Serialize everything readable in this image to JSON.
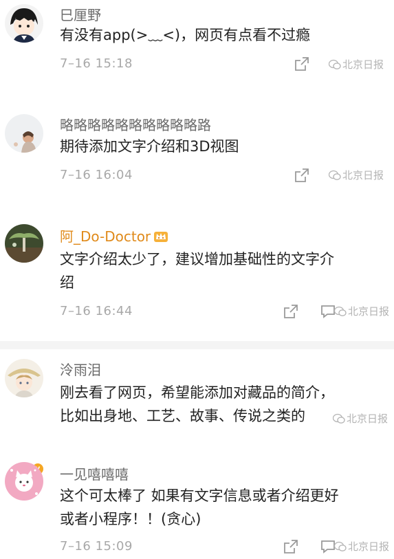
{
  "watermark": "北京日报",
  "comments": [
    {
      "username": "巳厘野",
      "text": [
        "有没有app(>﹏<)，网页有点看不过瘾"
      ],
      "time": "7–16 15:18"
    },
    {
      "username": "略略略略略略略略略略路",
      "text": [
        "期待添加文字介绍和3D视图"
      ],
      "time": "7–16 16:04"
    },
    {
      "username": "阿_Do-Doctor",
      "verified_badge": "v",
      "text": [
        "文字介绍太少了，建议增加基础性的文字介",
        "绍"
      ],
      "time": "7–16 16:44"
    },
    {
      "username": "泠雨泪",
      "text": [
        "刚去看了网页，希望能添加对藏品的简介，",
        "比如出身地、工艺、故事、传说之类的"
      ],
      "time": ""
    },
    {
      "username": "一见嘻嘻嘻",
      "text": [
        "这个可太棒了 如果有文字信息或者介绍更好",
        "或者小程序！！(贪心)"
      ],
      "time": "7–16 15:09"
    }
  ],
  "colors": {
    "username": "#6b6b6b",
    "username_gold": "#e08a1a",
    "text": "#222222",
    "time": "#a8a8a8",
    "badge": "#f5a623"
  }
}
